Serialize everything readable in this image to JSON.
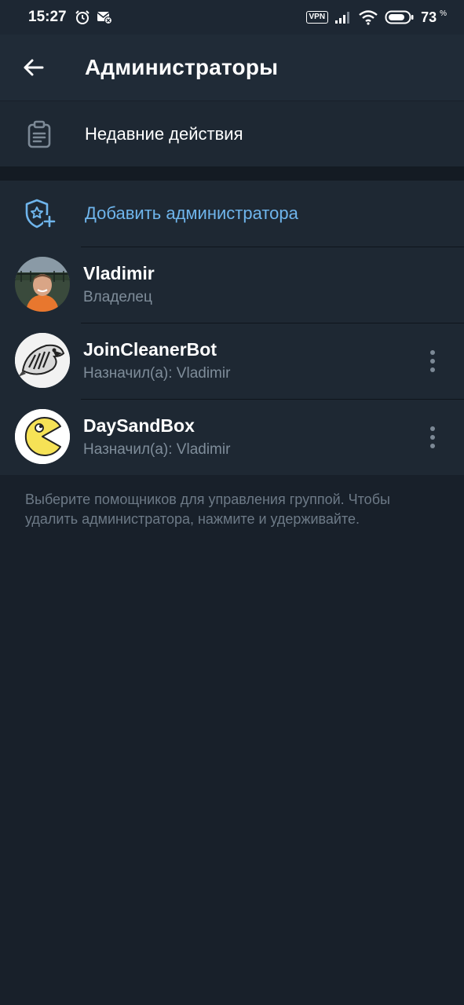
{
  "status_bar": {
    "time": "15:27",
    "vpn": "VPN",
    "battery": "73",
    "battery_sign": "%",
    "icons": [
      "alarm-icon",
      "mail-muted-icon",
      "signal-icon",
      "wifi-icon",
      "battery-icon"
    ]
  },
  "header": {
    "title": "Администраторы",
    "back_icon": "arrow-left-icon"
  },
  "recent": {
    "label": "Недавние действия",
    "icon": "clipboard-icon"
  },
  "admins": {
    "add_label": "Добавить администратора",
    "add_icon": "shield-star-plus-icon",
    "items": [
      {
        "name": "Vladimir",
        "subtitle": "Владелец",
        "avatar": "photo-avatar",
        "menu": false
      },
      {
        "name": "JoinCleanerBot",
        "subtitle": "Назначил(а): Vladimir",
        "avatar": "fish-avatar",
        "menu": true
      },
      {
        "name": "DaySandBox",
        "subtitle": "Назначил(а): Vladimir",
        "avatar": "pacman-avatar",
        "menu": true
      }
    ]
  },
  "hint_text": "Выберите помощников для управления группой. Чтобы удалить администратора, нажмите и удерживайте.",
  "colors": {
    "background": "#18202a",
    "surface": "#1e2833",
    "appbar": "#202b37",
    "accent": "#6fb5ec",
    "secondary_text": "#7f8d9a"
  }
}
